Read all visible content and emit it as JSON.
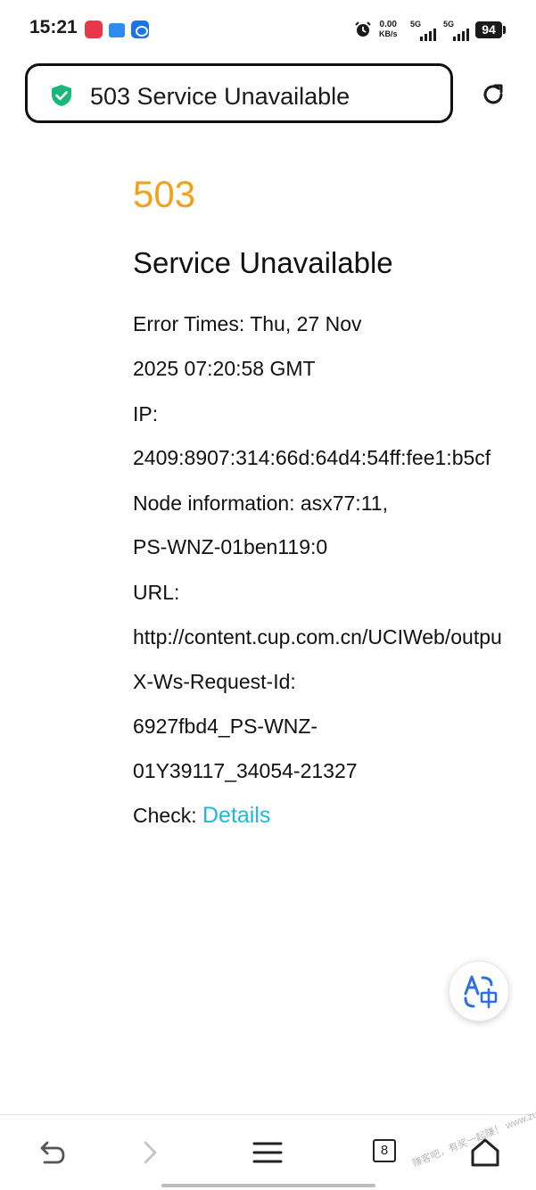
{
  "status_bar": {
    "time": "15:21",
    "net_speed_value": "0.00",
    "net_speed_unit": "KB/s",
    "signal1_label": "5G",
    "signal2_label": "5G",
    "battery": "94"
  },
  "address_bar": {
    "page_title": "503 Service Unavailable"
  },
  "error_page": {
    "code": "503",
    "title": "Service Unavailable",
    "lines": [
      "Error Times: Thu, 27 Nov",
      "2025 07:20:58 GMT",
      "IP:",
      "2409:8907:314:66d:64d4:54ff:fee1:b5cf",
      "Node information: asx77:11,",
      "PS-WNZ-01ben119:0",
      "URL:",
      "http://content.cup.com.cn/UCIWeb/outpu",
      "X-Ws-Request-Id:",
      "6927fbd4_PS-WNZ-",
      "01Y39117_34054-21327"
    ],
    "check_label": "Check:",
    "details_link": "Details"
  },
  "bottom_nav": {
    "tab_count": "8",
    "watermark": "赚客吧，有奖一起赚！ www.zuanke8.com"
  },
  "colors": {
    "error_code": "#f2a11d",
    "link": "#1cb8e0",
    "shield": "#19b77a",
    "translate_icon": "#2f6fe4"
  }
}
